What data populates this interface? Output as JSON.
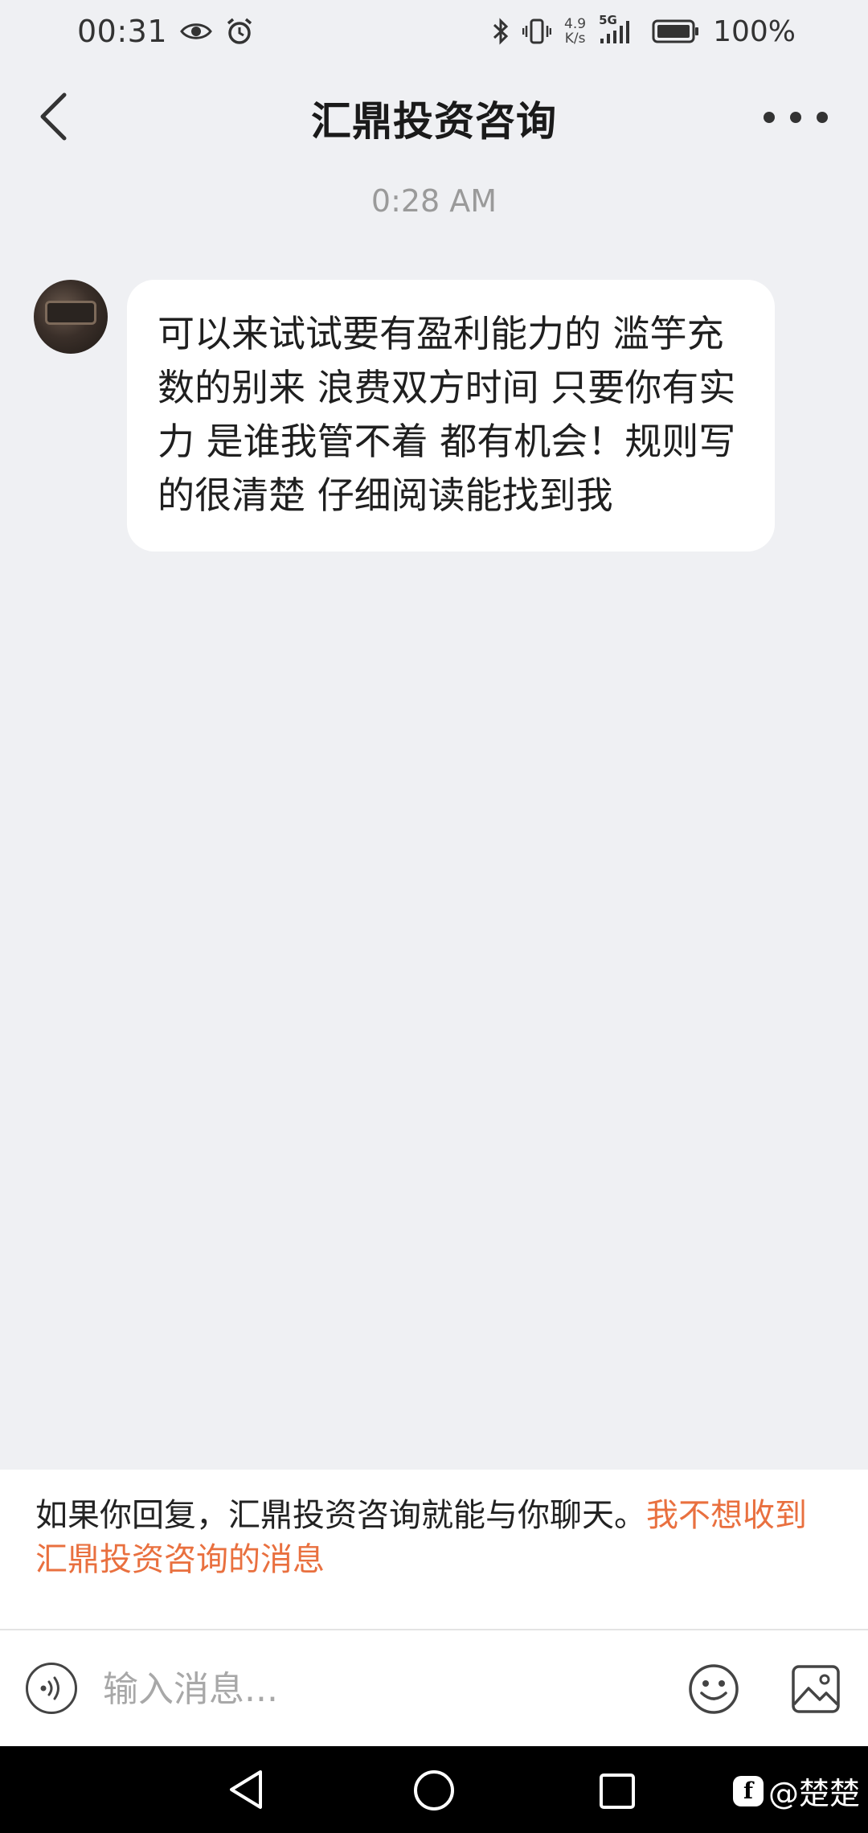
{
  "status_bar": {
    "time": "00:31",
    "network_speed_value": "4.9",
    "network_speed_unit": "K/s",
    "signal_label": "5G",
    "battery": "100%",
    "icons": [
      "eye-icon",
      "alarm-icon",
      "bluetooth-icon",
      "vibrate-icon",
      "signal-icon",
      "battery-icon"
    ]
  },
  "header": {
    "title": "汇鼎投资咨询",
    "back_icon": "chevron-left-icon",
    "more_icon": "more-horizontal-icon"
  },
  "chat": {
    "timestamp": "0:28 AM",
    "messages": [
      {
        "from": "other",
        "text": "可以来试试要有盈利能力的 滥竽充数的别来 浪费双方时间 只要你有实力 是谁我管不着 都有机会！规则写的很清楚 仔细阅读能找到我"
      }
    ]
  },
  "notice": {
    "text": "如果你回复，汇鼎投资咨询就能与你聊天。",
    "link": "我不想收到汇鼎投资咨询的消息",
    "link_color": "#e9703f"
  },
  "input_bar": {
    "placeholder": "输入消息...",
    "voice_icon": "voice-icon",
    "emoji_icon": "emoji-icon",
    "image_icon": "image-icon"
  },
  "nav_bar": {
    "watermark": "@楚楚"
  },
  "colors": {
    "background": "#eff0f3",
    "bubble": "#ffffff",
    "accent": "#e9703f"
  }
}
